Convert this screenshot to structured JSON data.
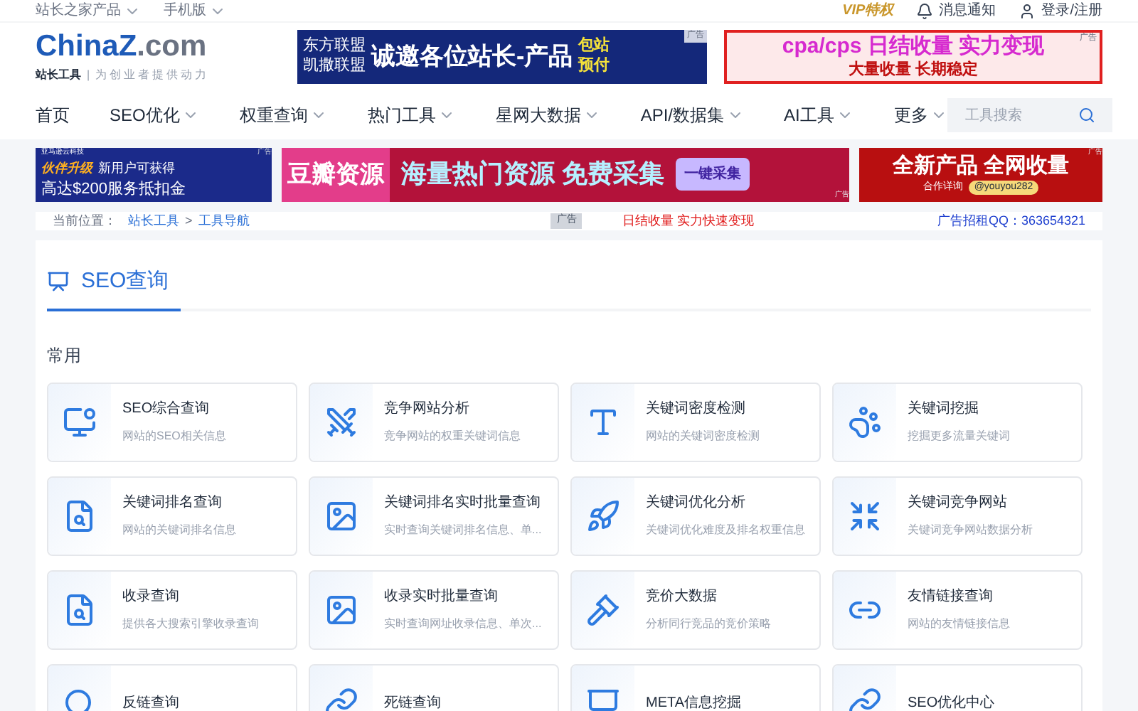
{
  "top_bar": {
    "left_links": [
      {
        "label": "站长之家产品",
        "dropdown": true
      },
      {
        "label": "手机版",
        "dropdown": true
      }
    ],
    "vip": "VIP特权",
    "notice": "消息通知",
    "login": "登录/注册"
  },
  "header": {
    "logo": {
      "main": "ChinaZ",
      "suffix": ".com",
      "tag": "站长工具",
      "divider": "|",
      "slogan": "为创业者提供动力"
    },
    "ads": [
      {
        "lines": [
          "东方联盟",
          "凯撒联盟"
        ],
        "headline": "诚邀各位站长-产品",
        "badge": [
          "包站",
          "预付"
        ],
        "mark": "广告"
      },
      {
        "headline": "cpa/cps 日结收量 实力变现",
        "sub": "大量收量 长期稳定",
        "mark": "广告"
      }
    ]
  },
  "nav": {
    "items": [
      {
        "label": "首页",
        "dropdown": false
      },
      {
        "label": "SEO优化",
        "dropdown": true
      },
      {
        "label": "权重查询",
        "dropdown": true
      },
      {
        "label": "热门工具",
        "dropdown": true
      },
      {
        "label": "星网大数据",
        "dropdown": true
      },
      {
        "label": "API/数据集",
        "dropdown": true
      },
      {
        "label": "AI工具",
        "dropdown": true
      },
      {
        "label": "更多",
        "dropdown": true
      }
    ],
    "search": {
      "placeholder": "工具搜索"
    }
  },
  "banners": [
    {
      "small": "亚马逊云科技",
      "lines": [
        "伙伴升级",
        "新用户可获得",
        "高达$200服务抵扣金"
      ],
      "mark": "广告"
    },
    {
      "brand": "豆瓣资源",
      "headline": "海量热门资源 免费采集",
      "button": "一键采集",
      "mark": "广告"
    },
    {
      "headline": "全新产品 全网收量",
      "sub": "合作详询",
      "contact": "@youyou282",
      "mark": "广告"
    }
  ],
  "breadcrumb": {
    "label": "当前位置：",
    "links": [
      "站长工具",
      "工具导航"
    ],
    "separator": ">",
    "ad_mark": "广告",
    "promo": "日结收量 实力快速变现",
    "contact": "广告招租QQ：363654321"
  },
  "section": {
    "title": "SEO查询",
    "group": "常用",
    "tools": [
      {
        "title": "SEO综合查询",
        "desc": "网站的SEO相关信息"
      },
      {
        "title": "竞争网站分析",
        "desc": "竞争网站的权重关键词信息"
      },
      {
        "title": "关键词密度检测",
        "desc": "网站的关键词密度检测"
      },
      {
        "title": "关键词挖掘",
        "desc": "挖掘更多流量关键词"
      },
      {
        "title": "关键词排名查询",
        "desc": "网站的关键词排名信息"
      },
      {
        "title": "关键词排名实时批量查询",
        "desc": "实时查询关键词排名信息、单..."
      },
      {
        "title": "关键词优化分析",
        "desc": "关键词优化难度及排名权重信息"
      },
      {
        "title": "关键词竞争网站",
        "desc": "关键词竞争网站数据分析"
      },
      {
        "title": "收录查询",
        "desc": "提供各大搜索引擎收录查询"
      },
      {
        "title": "收录实时批量查询",
        "desc": "实时查询网址收录信息、单次..."
      },
      {
        "title": "竞价大数据",
        "desc": "分析同行竞品的竞价策略"
      },
      {
        "title": "友情链接查询",
        "desc": "网站的友情链接信息"
      },
      {
        "title": "反链查询"
      },
      {
        "title": "死链查询"
      },
      {
        "title": "META信息挖掘"
      },
      {
        "title": "SEO优化中心"
      }
    ]
  }
}
